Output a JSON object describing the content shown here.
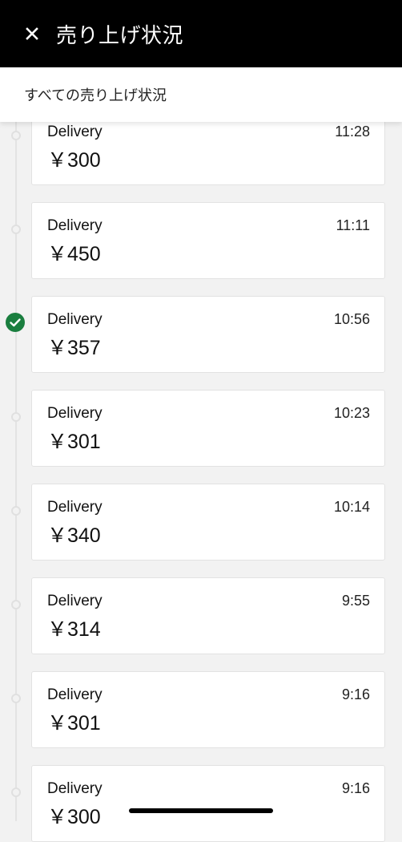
{
  "header": {
    "title": "売り上げ状況",
    "close_icon": "close-icon"
  },
  "filter": {
    "label": "すべての売り上げ状況"
  },
  "colors": {
    "header_bg": "#000000",
    "check_green": "#1a7e3f"
  },
  "trips": [
    {
      "type": "Delivery",
      "amount": "￥300",
      "time": "11:28",
      "selected": false
    },
    {
      "type": "Delivery",
      "amount": "￥450",
      "time": "11:11",
      "selected": false
    },
    {
      "type": "Delivery",
      "amount": "￥357",
      "time": "10:56",
      "selected": true
    },
    {
      "type": "Delivery",
      "amount": "￥301",
      "time": "10:23",
      "selected": false
    },
    {
      "type": "Delivery",
      "amount": "￥340",
      "time": "10:14",
      "selected": false
    },
    {
      "type": "Delivery",
      "amount": "￥314",
      "time": "9:55",
      "selected": false
    },
    {
      "type": "Delivery",
      "amount": "￥301",
      "time": "9:16",
      "selected": false
    },
    {
      "type": "Delivery",
      "amount": "￥300",
      "time": "9:16",
      "selected": false
    }
  ]
}
